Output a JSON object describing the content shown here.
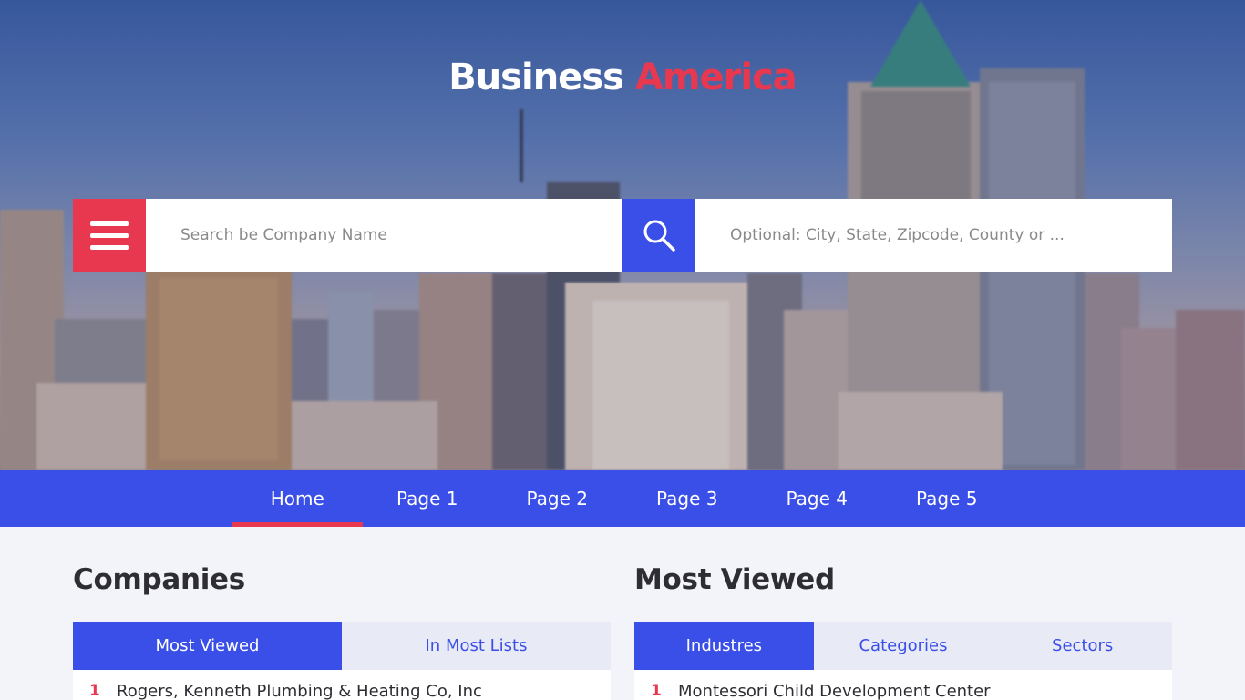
{
  "brand": {
    "part1": "Business",
    "part2": "America"
  },
  "search": {
    "company_placeholder": "Search be Company Name",
    "location_placeholder": "Optional: City, State, Zipcode, County or ..."
  },
  "icons": {
    "menu": "hamburger-menu-icon",
    "search": "search-icon"
  },
  "colors": {
    "accent_red": "#e8384f",
    "accent_blue": "#3a4ee8"
  },
  "nav": {
    "items": [
      {
        "label": "Home",
        "active": true
      },
      {
        "label": "Page 1"
      },
      {
        "label": "Page 2"
      },
      {
        "label": "Page 3"
      },
      {
        "label": "Page 4"
      },
      {
        "label": "Page 5"
      }
    ]
  },
  "companies": {
    "title": "Companies",
    "tabs": [
      {
        "label": "Most Viewed",
        "active": true
      },
      {
        "label": "In Most Lists"
      }
    ],
    "list": [
      {
        "num": "1",
        "name": "Rogers, Kenneth Plumbing & Heating Co, Inc"
      }
    ]
  },
  "most_viewed": {
    "title": "Most Viewed",
    "tabs": [
      {
        "label": "Industres",
        "active": true
      },
      {
        "label": "Categories"
      },
      {
        "label": "Sectors"
      }
    ],
    "list": [
      {
        "num": "1",
        "name": "Montessori Child Development Center"
      }
    ]
  }
}
